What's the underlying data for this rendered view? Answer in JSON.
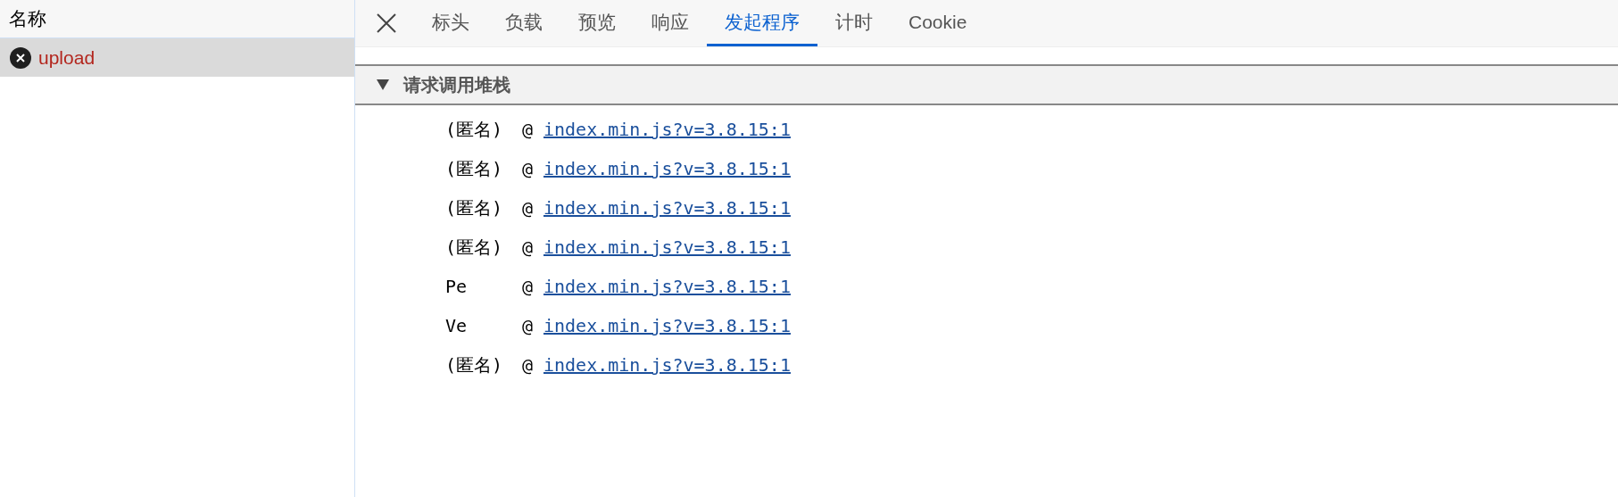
{
  "request_list": {
    "header": "名称",
    "rows": [
      {
        "name": "upload",
        "failed": true,
        "selected": true
      }
    ]
  },
  "tabs": [
    {
      "label": "标头",
      "selected": false
    },
    {
      "label": "负载",
      "selected": false
    },
    {
      "label": "预览",
      "selected": false
    },
    {
      "label": "响应",
      "selected": false
    },
    {
      "label": "发起程序",
      "selected": true
    },
    {
      "label": "计时",
      "selected": false
    },
    {
      "label": "Cookie",
      "selected": false
    }
  ],
  "section": {
    "title": "请求调用堆栈",
    "expanded": true,
    "frames": [
      {
        "function": "(匿名)",
        "at": "@",
        "link": "index.min.js?v=3.8.15:1"
      },
      {
        "function": "(匿名)",
        "at": "@",
        "link": "index.min.js?v=3.8.15:1"
      },
      {
        "function": "(匿名)",
        "at": "@",
        "link": "index.min.js?v=3.8.15:1"
      },
      {
        "function": "(匿名)",
        "at": "@",
        "link": "index.min.js?v=3.8.15:1"
      },
      {
        "function": "Pe",
        "at": "@",
        "link": "index.min.js?v=3.8.15:1"
      },
      {
        "function": "Ve",
        "at": "@",
        "link": "index.min.js?v=3.8.15:1"
      },
      {
        "function": "(匿名)",
        "at": "@",
        "link": "index.min.js?v=3.8.15:1"
      }
    ]
  }
}
